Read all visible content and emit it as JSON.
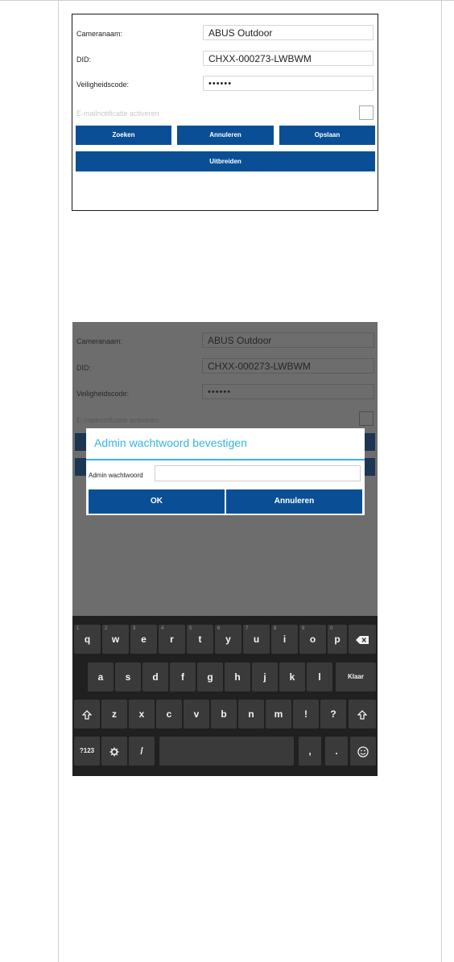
{
  "screen1": {
    "camera_name_label": "Cameranaam:",
    "camera_name_value": "ABUS Outdoor",
    "did_label": "DID:",
    "did_value": "CHXX-000273-LWBWM",
    "security_label": "Veiligheidscode:",
    "security_value": "••••••",
    "email_label": "E-mailnotificatie activeren",
    "btn_search": "Zoeken",
    "btn_cancel": "Annuleren",
    "btn_save": "Opslaan",
    "btn_expand": "Uitbreiden"
  },
  "screen2": {
    "camera_name_label": "Cameranaam:",
    "camera_name_value": "ABUS Outdoor",
    "did_label": "DID:",
    "did_value": "CHXX-000273-LWBWM",
    "security_label": "Veiligheidscode:",
    "security_value": "••••••",
    "email_label": "E-mailnotificatie activeren",
    "dialog": {
      "title": "Admin wachtwoord bevestigen",
      "field_label": "Admin wachtwoord",
      "ok": "OK",
      "cancel": "Annuleren"
    },
    "keyboard": {
      "row1": [
        {
          "key": "q",
          "hint": "1"
        },
        {
          "key": "w",
          "hint": "2"
        },
        {
          "key": "e",
          "hint": "3"
        },
        {
          "key": "r",
          "hint": "4"
        },
        {
          "key": "t",
          "hint": "5"
        },
        {
          "key": "y",
          "hint": "6"
        },
        {
          "key": "u",
          "hint": "7"
        },
        {
          "key": "i",
          "hint": "8"
        },
        {
          "key": "o",
          "hint": "9"
        },
        {
          "key": "p",
          "hint": "0"
        }
      ],
      "row2": [
        "a",
        "s",
        "d",
        "f",
        "g",
        "h",
        "j",
        "k",
        "l"
      ],
      "row2_action": "Klaar",
      "row3": [
        "z",
        "x",
        "c",
        "v",
        "b",
        "n",
        "m",
        "!",
        "?"
      ],
      "row4_symbols": "?123",
      "row4_slash": "/",
      "row4_comma": ",",
      "row4_period": "."
    },
    "icons": {
      "backspace": "backspace-icon",
      "shift": "shift-icon",
      "settings": "gear-icon",
      "emoji": "emoji-icon"
    }
  }
}
